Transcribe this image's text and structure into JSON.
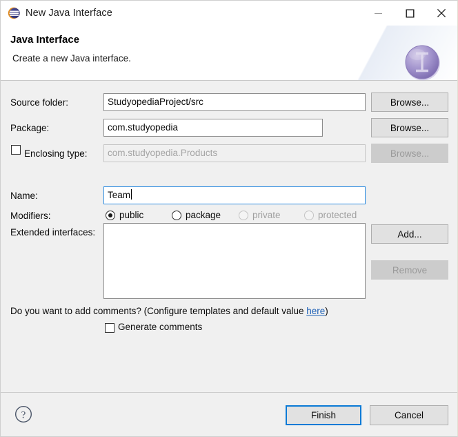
{
  "window": {
    "title": "New Java Interface",
    "icon": "eclipse-icon",
    "controls": {
      "minimize": "minimize-icon",
      "maximize": "maximize-icon",
      "close": "close-icon"
    }
  },
  "header": {
    "title": "Java Interface",
    "subtitle": "Create a new Java interface.",
    "icon": "java-interface-icon",
    "icon_letter": "I"
  },
  "form": {
    "source_folder": {
      "label": "Source folder:",
      "value": "StudyopediaProject/src",
      "browse_label": "Browse...",
      "enabled": true
    },
    "package": {
      "label": "Package:",
      "value": "com.studyopedia",
      "browse_label": "Browse...",
      "enabled": true
    },
    "enclosing_type": {
      "label": "Enclosing type:",
      "checked": false,
      "value": "com.studyopedia.Products",
      "browse_label": "Browse...",
      "enabled": false
    },
    "name": {
      "label": "Name:",
      "value": "Team",
      "focused": true
    },
    "modifiers": {
      "label": "Modifiers:",
      "options": [
        {
          "label": "public",
          "checked": true,
          "enabled": true
        },
        {
          "label": "package",
          "checked": false,
          "enabled": true
        },
        {
          "label": "private",
          "checked": false,
          "enabled": false
        },
        {
          "label": "protected",
          "checked": false,
          "enabled": false
        }
      ]
    },
    "extended_interfaces": {
      "label": "Extended interfaces:",
      "items": [],
      "add_label": "Add...",
      "remove_label": "Remove",
      "remove_enabled": false
    },
    "comments": {
      "question_before": "Do you want to add comments? (Configure templates and default value ",
      "link_text": "here",
      "question_after": ")",
      "checkbox_label": "Generate comments",
      "checked": false
    }
  },
  "footer": {
    "help_icon": "help-icon",
    "finish_label": "Finish",
    "cancel_label": "Cancel"
  },
  "colors": {
    "dialog_bg": "#f0f0f0",
    "header_bg": "#ffffff",
    "accent_blue": "#0a7ad6",
    "link_blue": "#1c5fb5",
    "icon_purple": "#9a8cc4",
    "disabled_text": "#a0a0a0"
  }
}
